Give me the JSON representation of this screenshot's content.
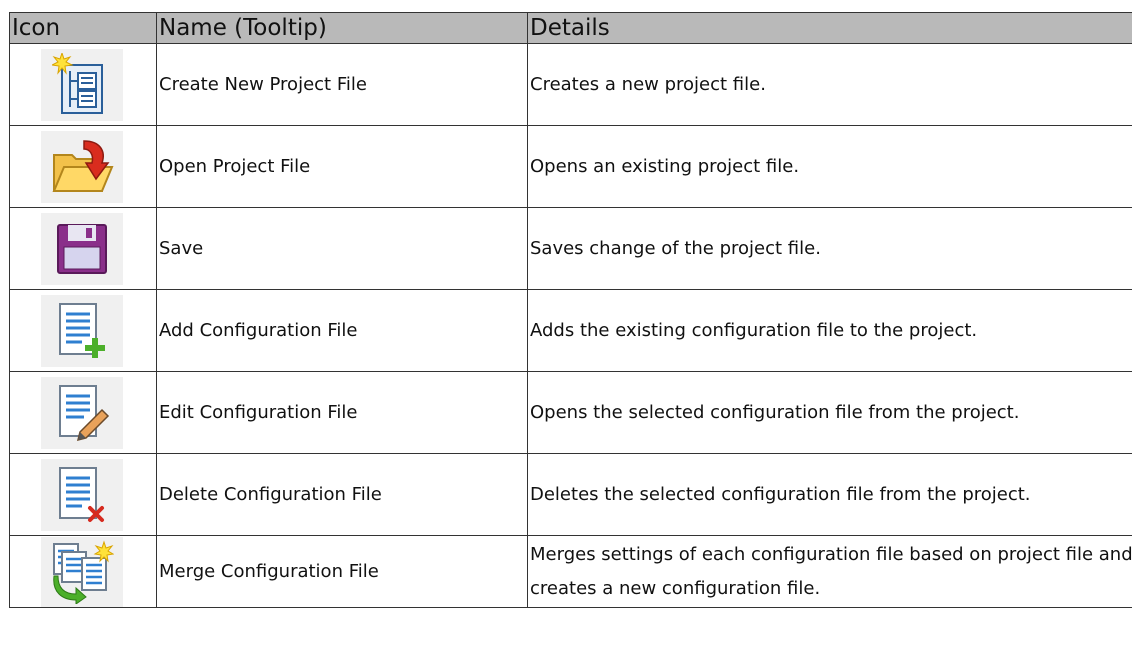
{
  "header": {
    "col_icon": "Icon",
    "col_name": "Name (Tooltip)",
    "col_details": "Details"
  },
  "rows": [
    {
      "icon": "new-project-icon",
      "name": "Create New Project File",
      "details": "Creates a new project file."
    },
    {
      "icon": "open-folder-icon",
      "name": "Open Project File",
      "details": "Opens an existing project file."
    },
    {
      "icon": "save-disk-icon",
      "name": "Save",
      "details": "Saves change of the project file."
    },
    {
      "icon": "add-config-icon",
      "name": "Add Configuration File",
      "details": "Adds the existing configuration file to the project."
    },
    {
      "icon": "edit-config-icon",
      "name": "Edit Configuration File",
      "details": "Opens the selected configuration file from the project."
    },
    {
      "icon": "delete-config-icon",
      "name": "Delete Configuration File",
      "details": "Deletes the selected configuration file from the project."
    },
    {
      "icon": "merge-config-icon",
      "name": "Merge Configuration File",
      "details": "Merges settings of each configuration file based on project file and creates a new configuration file."
    }
  ],
  "colors": {
    "header_bg": "#b9b9b9",
    "border": "#333333",
    "icon_bg": "#f0f0f0"
  }
}
